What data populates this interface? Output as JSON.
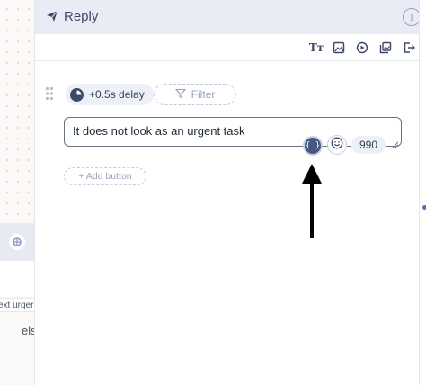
{
  "header": {
    "title": "Reply",
    "info_glyph": "i"
  },
  "toolbar": {
    "text_style_glyph": "Tт",
    "icons": [
      "text-style-icon",
      "image-icon",
      "video-icon",
      "gallery-icon",
      "exit-icon"
    ]
  },
  "block": {
    "delay_label": "+0.5s delay",
    "filter_label": "Filter",
    "message_text": "It does not look as an urgent task",
    "variable_glyph": "{ }",
    "char_count": "990",
    "add_button_label": "+ Add button"
  },
  "left_strip": {
    "partial_text_1": "ext urger",
    "partial_text_2": "els"
  },
  "colors": {
    "header_bg": "#e9ecf5",
    "accent": "#48577f",
    "text": "#1f2937"
  }
}
